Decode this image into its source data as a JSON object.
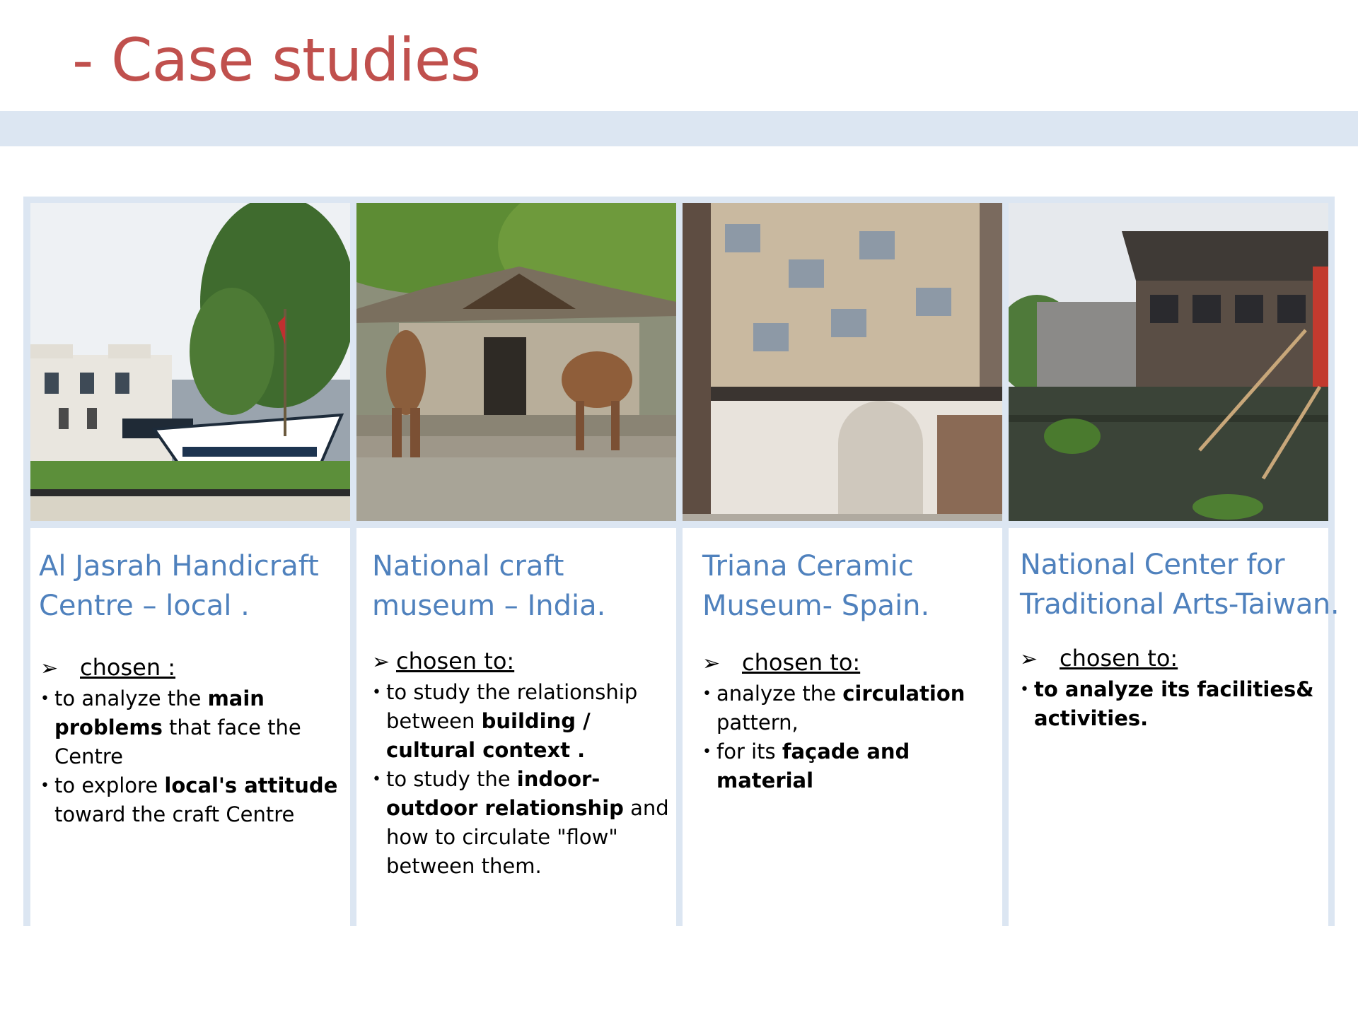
{
  "title": "- Case studies",
  "columns": [
    {
      "title_lines": [
        "Al Jasrah Handicraft",
        "Centre – local ."
      ],
      "photo_icon": "handicraft-centre-photo",
      "arrow_icon": "➢",
      "chosen_label": "chosen :",
      "bullets": [
        [
          {
            "t": "to analyze the "
          },
          {
            "t": "main",
            "b": true
          },
          {
            "t": " "
          },
          {
            "t": "problems",
            "b": true
          },
          {
            "t": " that face the Centre"
          }
        ],
        [
          {
            "t": "to explore "
          },
          {
            "t": "local's attitude",
            "b": true
          },
          {
            "t": " toward the craft Centre"
          }
        ]
      ]
    },
    {
      "title_lines": [
        "National craft",
        "museum – India."
      ],
      "photo_icon": "craft-museum-photo",
      "arrow_icon": "➢",
      "chosen_label": "chosen to:",
      "bullets": [
        [
          {
            "t": " to study the relationship between "
          },
          {
            "t": "building /  cultural context .",
            "b": true
          }
        ],
        [
          {
            "t": "to study the "
          },
          {
            "t": "indoor-outdoor relationship",
            "b": true
          },
          {
            "t": " and how to circulate \"flow\" between them."
          }
        ]
      ]
    },
    {
      "title_lines": [
        "Triana Ceramic",
        "Museum- Spain."
      ],
      "photo_icon": "ceramic-museum-photo",
      "arrow_icon": "➢",
      "chosen_label": "chosen to:",
      "bullets": [
        [
          {
            "t": "analyze the "
          },
          {
            "t": "circulation",
            "b": true
          },
          {
            "t": " pattern,"
          }
        ],
        [
          {
            "t": "for its "
          },
          {
            "t": "façade and material",
            "b": true
          }
        ]
      ]
    },
    {
      "title_lines": [
        "National Center for",
        "Traditional Arts-Taiwan."
      ],
      "photo_icon": "traditional-arts-photo",
      "arrow_icon": "➢",
      "chosen_label": "chosen to:",
      "bullets": [
        [
          {
            "t": "to analyze its facilities& activities.",
            "b": true
          }
        ]
      ]
    }
  ]
}
